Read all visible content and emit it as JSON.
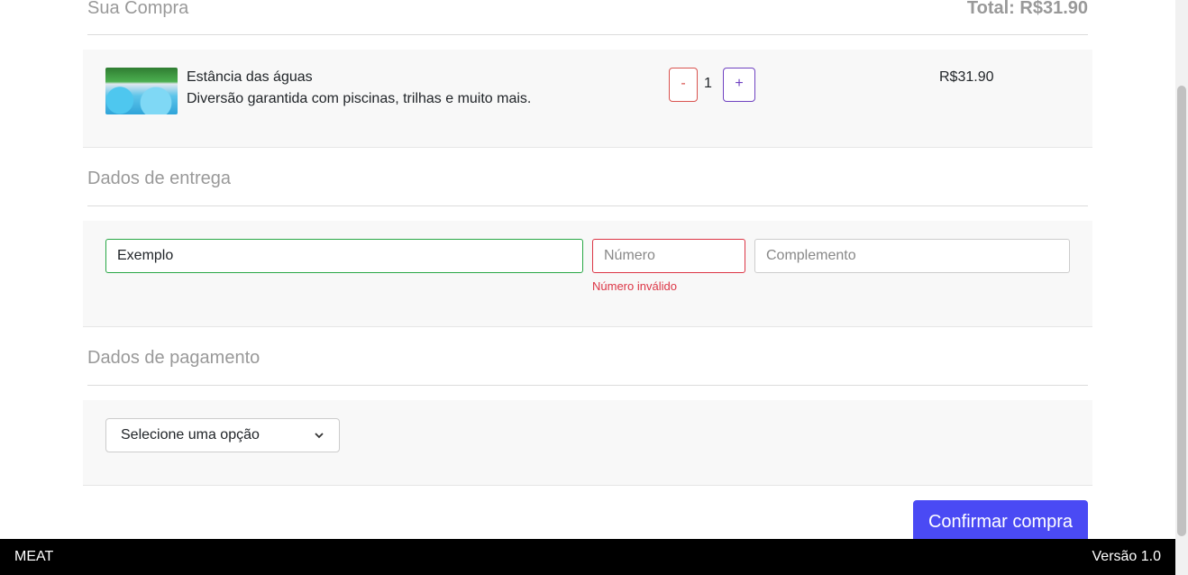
{
  "cart": {
    "title": "Sua Compra",
    "total": "Total: R$31.90",
    "item": {
      "name": "Estância das águas",
      "description": "Diversão garantida com piscinas, trilhas e muito mais.",
      "minus_label": "-",
      "quantity": "1",
      "plus_label": "+",
      "price": "R$31.90"
    }
  },
  "delivery": {
    "title": "Dados de entrega",
    "address_value": "Exemplo",
    "number_placeholder": "Número",
    "number_error": "Número inválido",
    "complement_placeholder": "Complemento"
  },
  "payment": {
    "title": "Dados de pagamento",
    "select_value": "Selecione uma opção"
  },
  "confirm_label": "Confirmar compra",
  "footer": {
    "brand": "MEAT",
    "version": "Versão 1.0"
  },
  "icons": {
    "select_caret": "chevron-down-icon"
  },
  "colors": {
    "accent": "#4a4af4",
    "error": "#dc3545",
    "valid": "#28a745",
    "plus": "#6f42c1"
  }
}
